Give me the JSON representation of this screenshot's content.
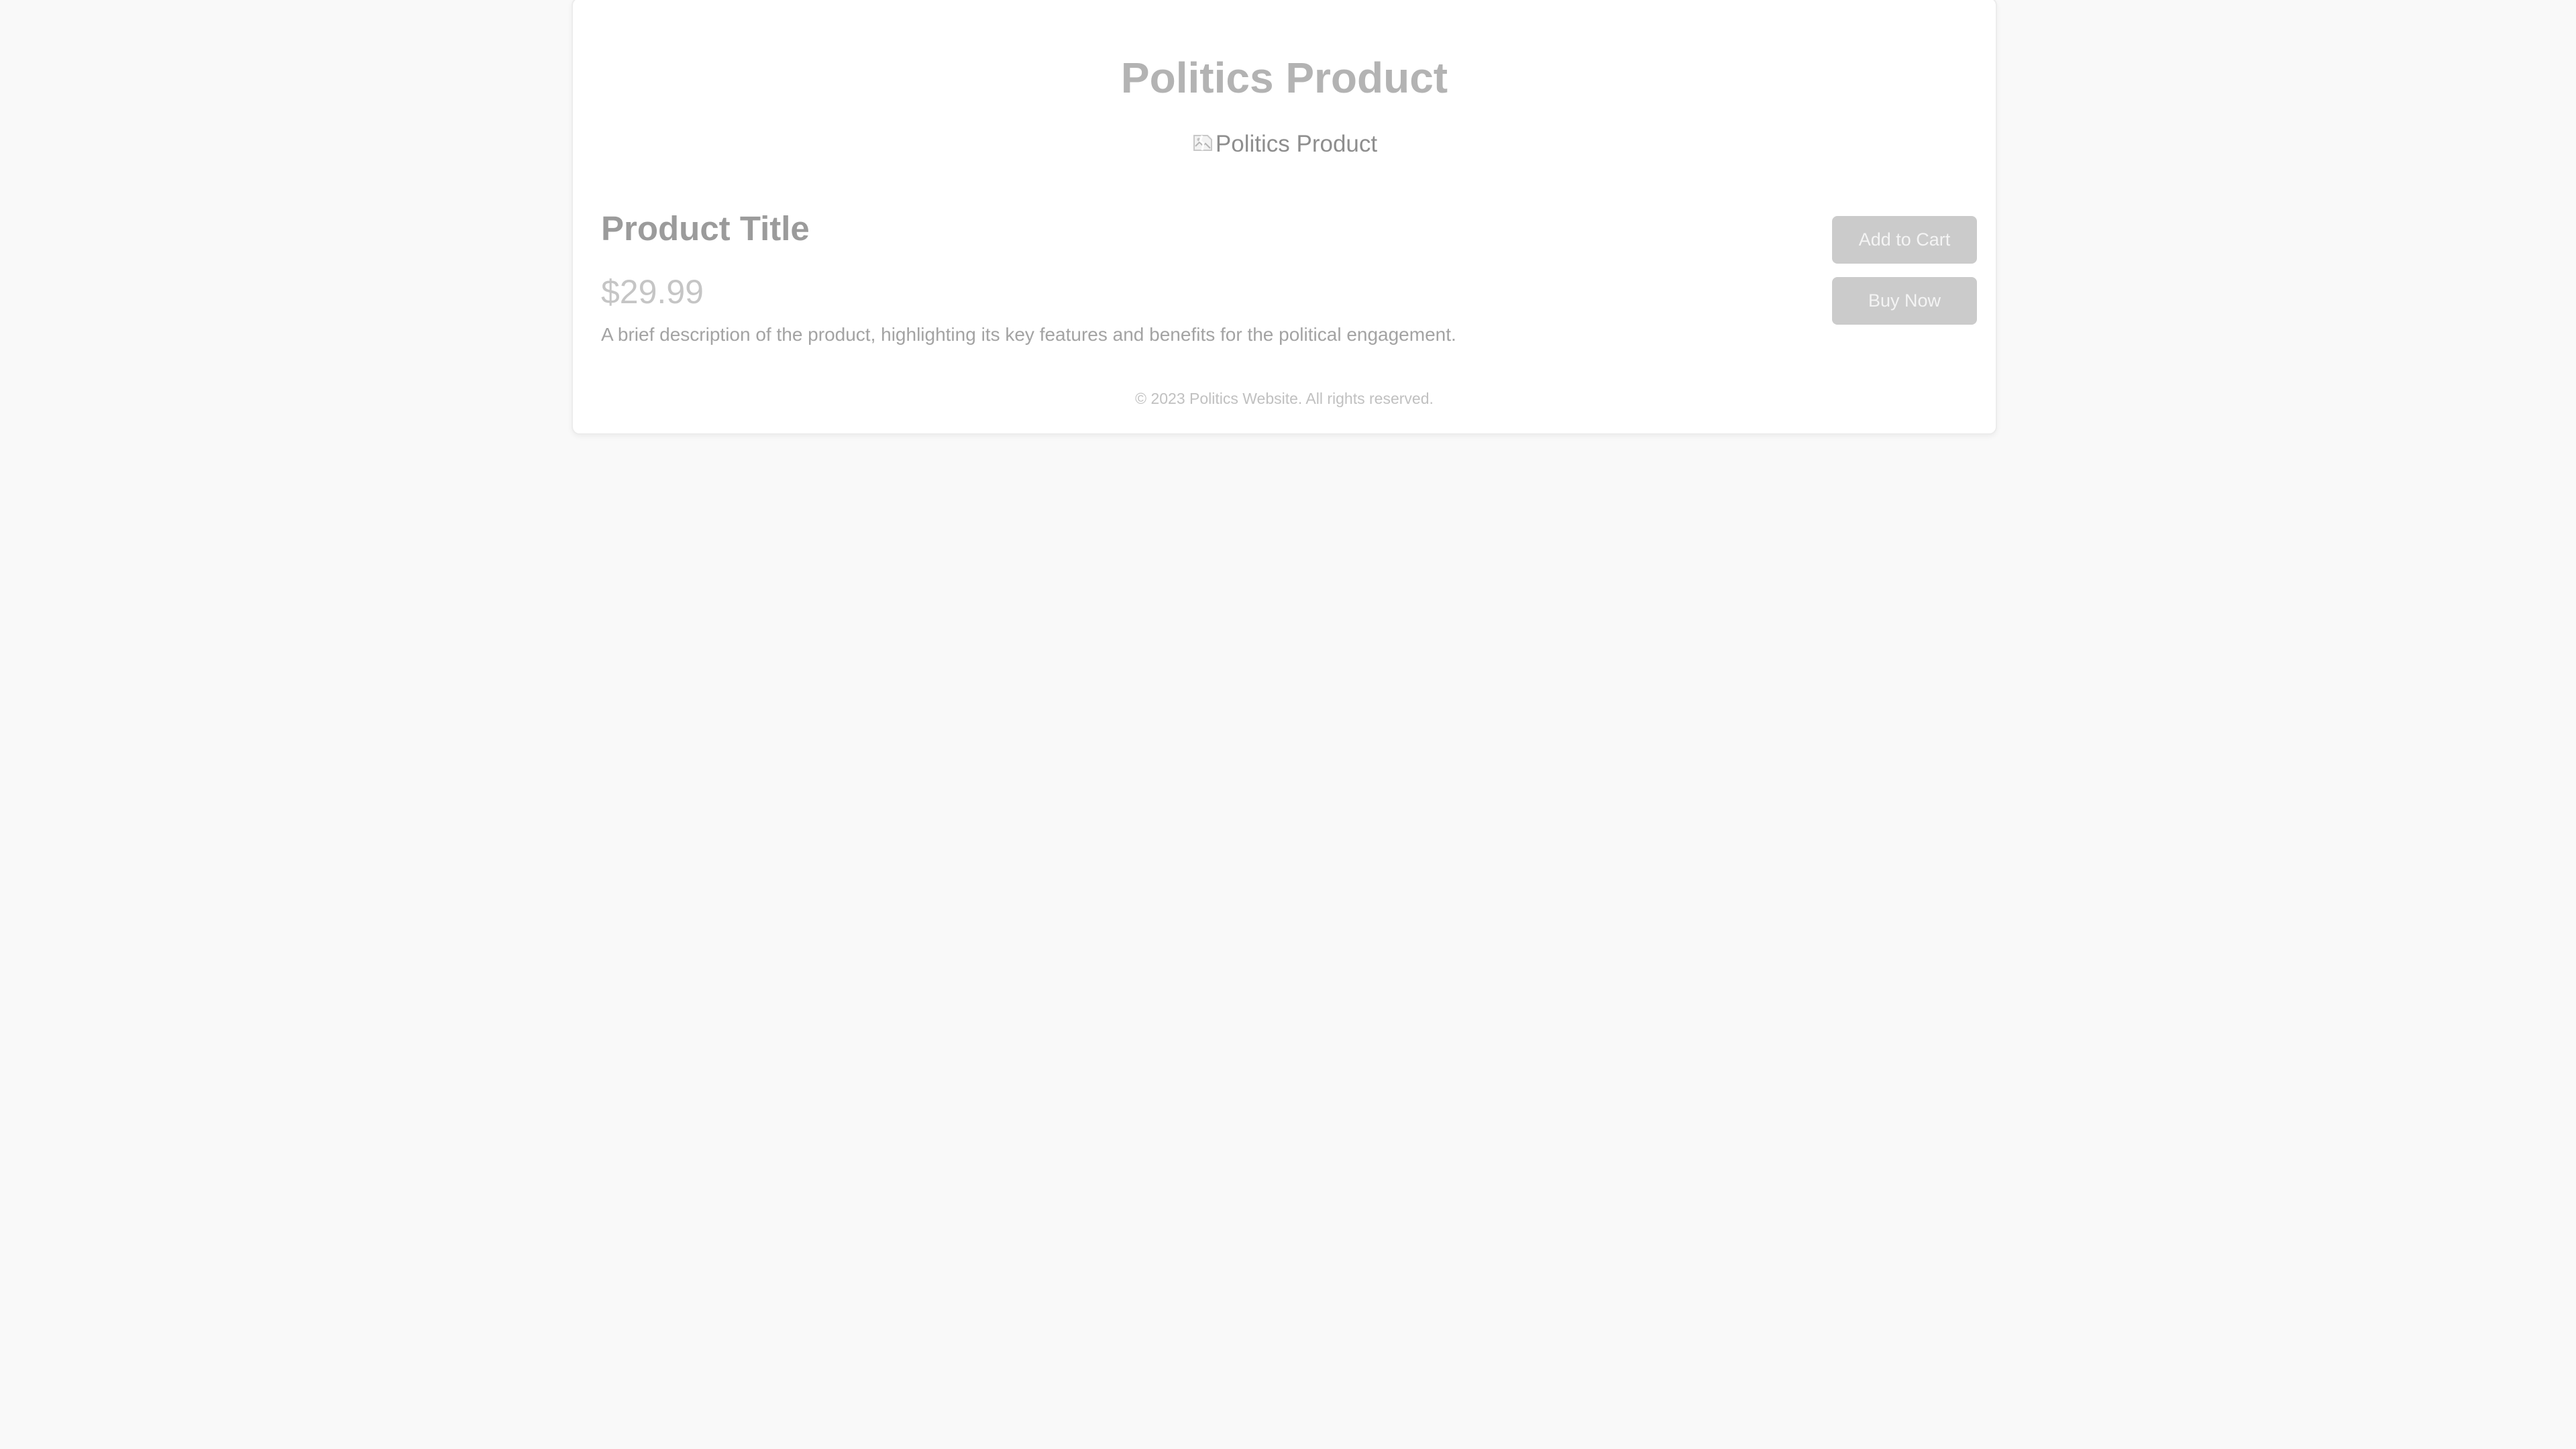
{
  "page": {
    "title": "Politics Product"
  },
  "product_image": {
    "alt_text": "Politics Product",
    "icon": "broken-image-icon"
  },
  "product": {
    "name": "Product Title",
    "price": "$29.99",
    "description": "A brief description of the product, highlighting its key features and benefits for the political engagement."
  },
  "actions": {
    "add_to_cart_label": "Add to Cart",
    "buy_now_label": "Buy Now"
  },
  "footer": {
    "text": "© 2023 Politics Website. All rights reserved."
  },
  "colors": {
    "background": "#f9f9f9",
    "card": "#ffffff",
    "button": "#cbcbcb",
    "title_text": "#b3b3b3"
  }
}
